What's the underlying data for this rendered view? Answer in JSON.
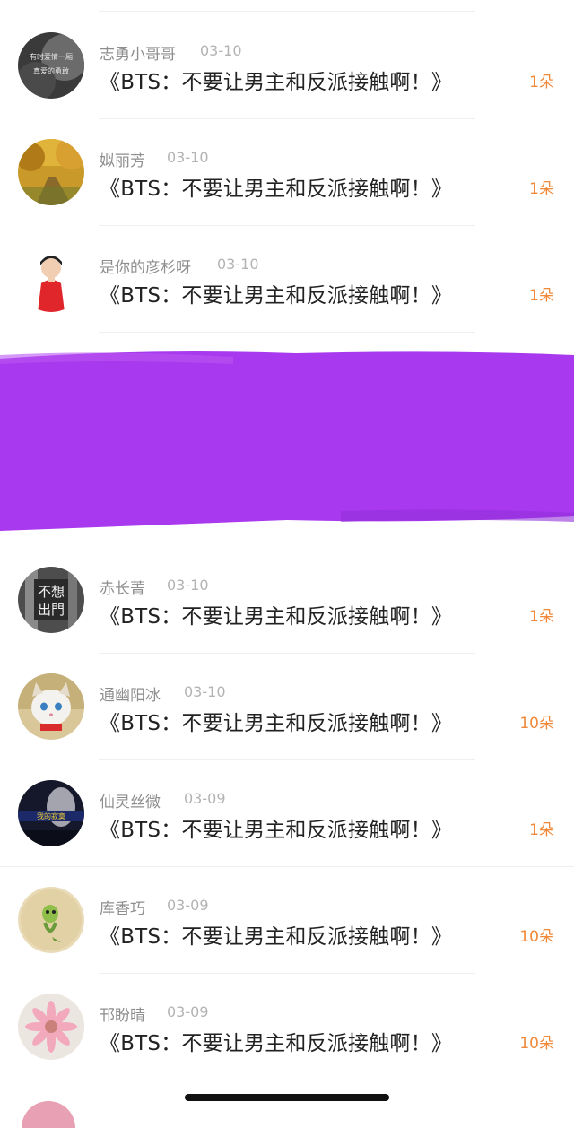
{
  "comments": [
    {
      "name": "志勇小哥哥",
      "date": "03-10",
      "title": "《BTS：不要让男主和反派接触啊！》",
      "gift": "1朵"
    },
    {
      "name": "姒丽芳",
      "date": "03-10",
      "title": "《BTS：不要让男主和反派接触啊！》",
      "gift": "1朵"
    },
    {
      "name": "是你的彦杉呀",
      "date": "03-10",
      "title": "《BTS：不要让男主和反派接触啊！》",
      "gift": "1朵"
    },
    {
      "name": "赤长菁",
      "date": "03-10",
      "title": "《BTS：不要让男主和反派接触啊！》",
      "gift": "1朵"
    },
    {
      "name": "通幽阳冰",
      "date": "03-10",
      "title": "《BTS：不要让男主和反派接触啊！》",
      "gift": "10朵"
    },
    {
      "name": "仙灵丝微",
      "date": "03-09",
      "title": "《BTS：不要让男主和反派接触啊！》",
      "gift": "1朵"
    },
    {
      "name": "库香巧",
      "date": "03-09",
      "title": "《BTS：不要让男主和反派接触啊！》",
      "gift": "10朵"
    },
    {
      "name": "邗盼晴",
      "date": "03-09",
      "title": "《BTS：不要让男主和反派接触啊！》",
      "gift": "10朵"
    }
  ],
  "avatar_texts": {
    "a1_line1": "有时爱情一厢",
    "a1_line2": "真爱的勇敢",
    "a4_line1": "不想",
    "a4_line2": "出門",
    "a6_band": "我的寂寞"
  },
  "colors": {
    "gift": "#f0893a",
    "redaction": "#a839ee",
    "name": "#8e8e8e",
    "title": "#222222"
  }
}
